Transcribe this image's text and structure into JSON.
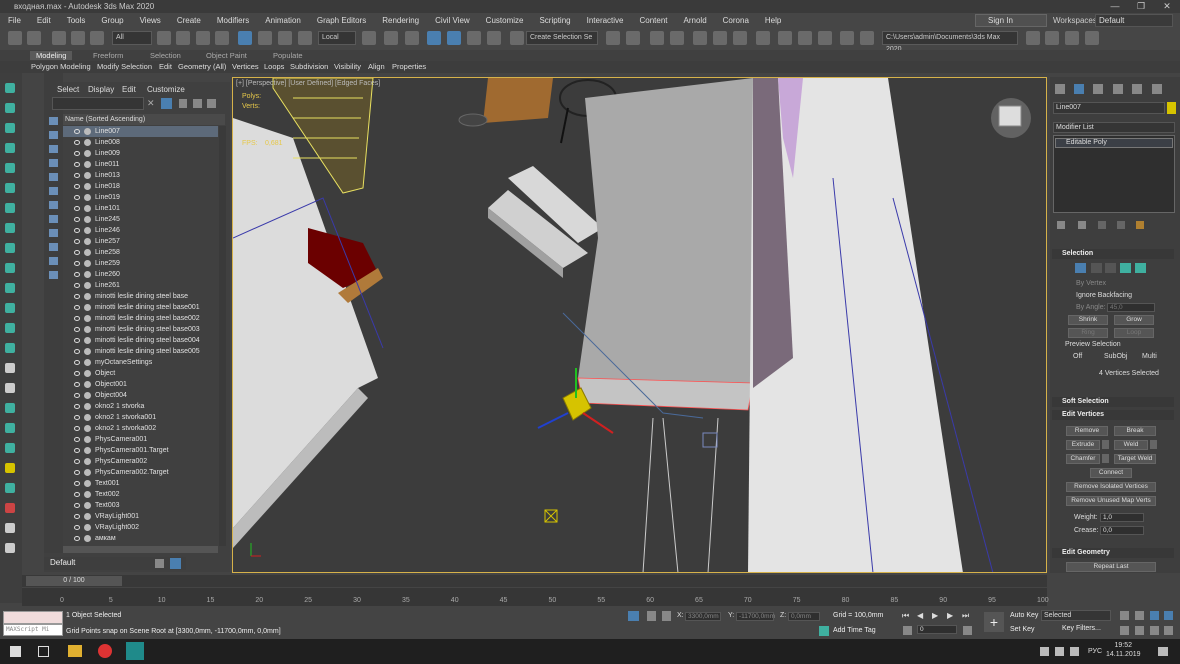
{
  "window": {
    "title": "входная.max - Autodesk 3ds Max 2020",
    "min": "—",
    "max": "❐",
    "close": "✕"
  },
  "menubar": [
    "File",
    "Edit",
    "Tools",
    "Group",
    "Views",
    "Create",
    "Modifiers",
    "Animation",
    "Graph Editors",
    "Rendering",
    "Civil View",
    "Customize",
    "Scripting",
    "Interactive",
    "Content",
    "Arnold",
    "Corona",
    "Help"
  ],
  "account": {
    "sign_in": "Sign In",
    "workspaces_label": "Workspaces:",
    "workspace": "Default"
  },
  "toolbar": {
    "filter": "All",
    "coord_system": "Local",
    "selection_set": "Create Selection Se",
    "path": "C:\\Users\\admin\\Documents\\3ds Max 2020"
  },
  "ribbon": {
    "tabs": [
      "Modeling",
      "Freeform",
      "Selection",
      "Object Paint",
      "Populate"
    ],
    "active_tab": "Modeling",
    "items": [
      "Polygon Modeling",
      "Modify Selection",
      "Edit",
      "Geometry (All)",
      "Vertices",
      "Loops",
      "Subdivision",
      "Visibility",
      "Align",
      "Properties"
    ]
  },
  "explorer": {
    "menu": [
      "Select",
      "Display",
      "Edit",
      "Customize"
    ],
    "column": "Name (Sorted Ascending)",
    "rows": [
      "Line007",
      "Line008",
      "Line009",
      "Line011",
      "Line013",
      "Line018",
      "Line019",
      "Line101",
      "Line245",
      "Line246",
      "Line257",
      "Line258",
      "Line259",
      "Line260",
      "Line261",
      "minotti leslie dining steel base",
      "minotti leslie dining steel base001",
      "minotti leslie dining steel base002",
      "minotti leslie dining steel base003",
      "minotti leslie dining steel base004",
      "minotti leslie dining steel base005",
      "myOctaneSettings",
      "Object",
      "Object001",
      "Object004",
      "okno2 1 stvorka",
      "okno2 1 stvorka001",
      "okno2 1 stvorka002",
      "PhysCamera001",
      "PhysCamera001.Target",
      "PhysCamera002",
      "PhysCamera002.Target",
      "Text001",
      "Text002",
      "Text003",
      "VRayLight001",
      "VRayLight002",
      "амкам"
    ],
    "selected_row": "Line007",
    "layer": "Default"
  },
  "viewport": {
    "label": "[+] [Perspective] [User Defined] [Edged Faces]",
    "stats": {
      "polys_label": "Polys:",
      "verts_label": "Verts:",
      "fps_label": "FPS:",
      "fps_value": "0,681"
    }
  },
  "command_panel": {
    "object_name": "Line007",
    "object_color": "#d6c300",
    "modifier_list": "Modifier List",
    "stack_item": "Editable Poly",
    "selection": {
      "title": "Selection",
      "by_vertex": "By Vertex",
      "ignore_backfacing": "Ignore Backfacing",
      "by_angle": "By Angle:",
      "by_angle_value": "45,0",
      "shrink": "Shrink",
      "grow": "Grow",
      "ring": "Ring",
      "loop": "Loop",
      "preview": "Preview Selection",
      "preview_opts": [
        "Off",
        "SubObj",
        "Multi"
      ],
      "status": "4 Vertices Selected"
    },
    "soft_selection": "Soft Selection",
    "edit_vertices": {
      "title": "Edit Vertices",
      "remove": "Remove",
      "break": "Break",
      "extrude": "Extrude",
      "weld": "Weld",
      "chamfer": "Chamfer",
      "target_weld": "Target Weld",
      "connect": "Connect",
      "remove_isolated": "Remove Isolated Vertices",
      "remove_unused": "Remove Unused Map Verts",
      "weight_label": "Weight:",
      "weight": "1,0",
      "crease_label": "Crease:",
      "crease": "0,0"
    },
    "edit_geometry": {
      "title": "Edit Geometry",
      "repeat_last": "Repeat Last"
    }
  },
  "timeline": {
    "frame": "0 / 100",
    "ticks": [
      "0",
      "5",
      "10",
      "15",
      "20",
      "25",
      "30",
      "35",
      "40",
      "45",
      "50",
      "55",
      "60",
      "65",
      "70",
      "75",
      "80",
      "85",
      "90",
      "95",
      "100"
    ]
  },
  "status": {
    "maxscript": "MAXScript Mi",
    "selected": "1 Object Selected",
    "prompt": "Grid Points snap on Scene Root at [3300,0mm, -11700,0mm, 0,0mm]",
    "x_label": "X:",
    "x": "3300,0mm",
    "y_label": "Y:",
    "y": "-11700,0mm",
    "z_label": "Z:",
    "z": "0,0mm",
    "grid": "Grid = 100,0mm",
    "add_time_tag": "Add Time Tag",
    "frame_input": "0",
    "auto_key": "Auto Key",
    "set_key": "Set Key",
    "selected_drop": "Selected",
    "key_filters": "Key Filters..."
  },
  "taskbar": {
    "time": "19:52",
    "date": "14.11.2019",
    "lang": "РУС"
  }
}
